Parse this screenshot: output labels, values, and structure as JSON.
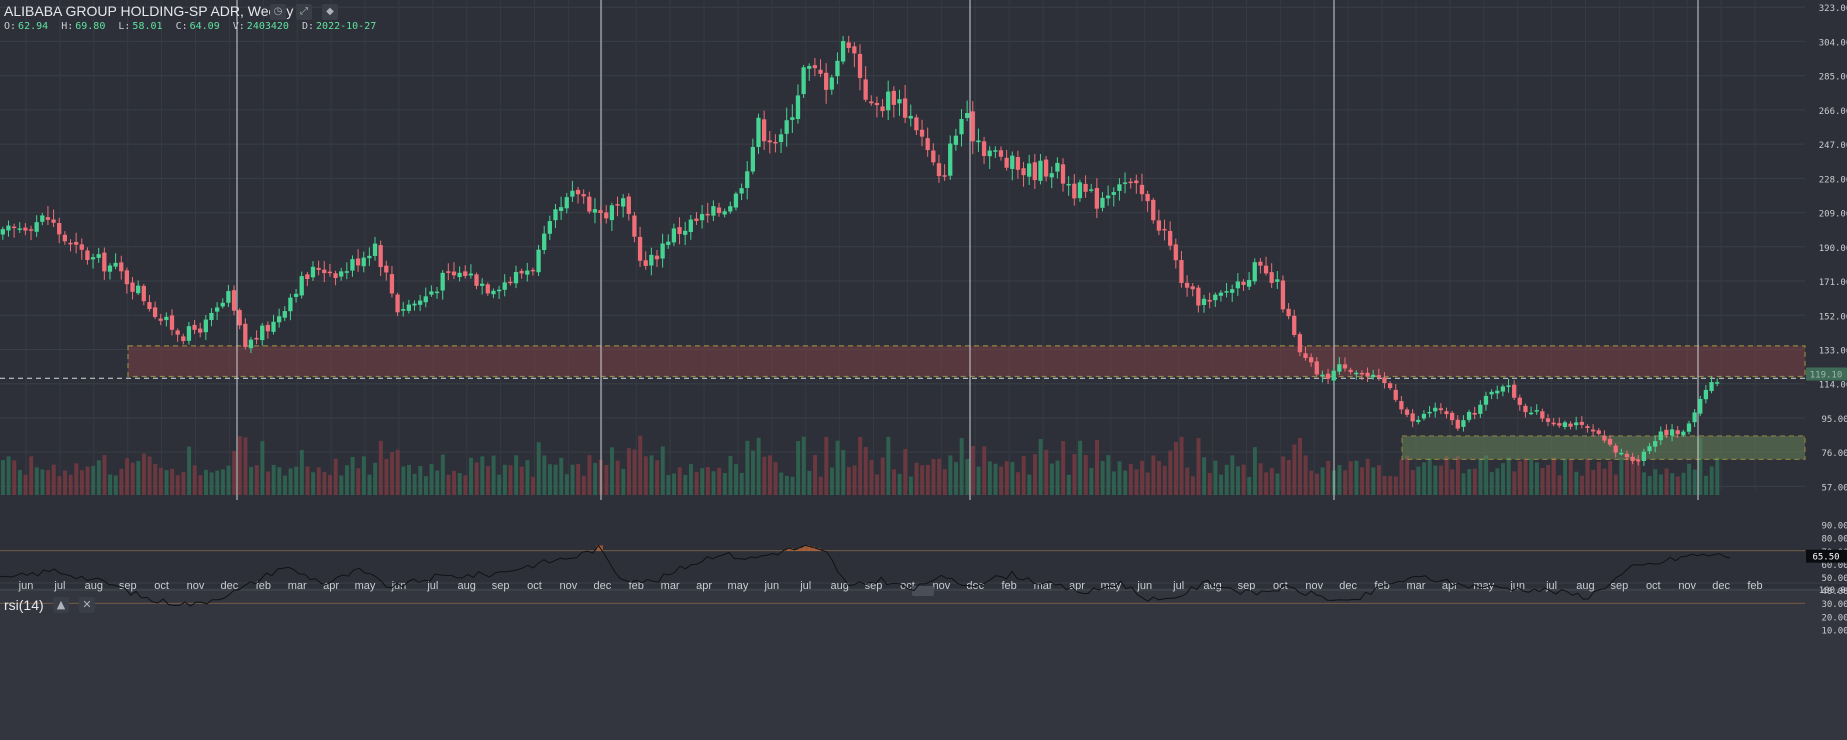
{
  "header": {
    "title": "ALIBABA GROUP HOLDING-SP ADR, Weekly",
    "ohlc": [
      {
        "key": "O:",
        "value": "62.94"
      },
      {
        "key": "H:",
        "value": "69.80"
      },
      {
        "key": "L:",
        "value": "58.01"
      },
      {
        "key": "C:",
        "value": "64.09"
      },
      {
        "key": "V:",
        "value": "2403420"
      },
      {
        "key": "D:",
        "value": "2022-10-27"
      }
    ]
  },
  "rsi_label": "rsi(14)",
  "chart_data": [
    {
      "type": "candlestick",
      "title": "ALIBABA GROUP HOLDING-SP ADR, Weekly",
      "y_ticks": [
        "323.00",
        "304.00",
        "285.00",
        "266.00",
        "247.00",
        "228.00",
        "209.00",
        "190.00",
        "171.00",
        "152.00",
        "133.00",
        "114.00",
        "95.00",
        "76.00",
        "57.00",
        "100.00"
      ],
      "x_ticks": [
        "jun",
        "jul",
        "aug",
        "sep",
        "oct",
        "nov",
        "dec",
        "feb",
        "mar",
        "apr",
        "may",
        "jun",
        "jul",
        "aug",
        "sep",
        "oct",
        "nov",
        "dec",
        "feb",
        "mar",
        "apr",
        "may",
        "jun",
        "jul",
        "aug",
        "sep",
        "oct",
        "nov",
        "dec",
        "feb",
        "mar",
        "apr",
        "may",
        "jun",
        "jul",
        "aug",
        "sep",
        "oct",
        "nov",
        "dec",
        "feb",
        "mar",
        "apr",
        "may",
        "jun",
        "jul",
        "aug",
        "sep",
        "oct",
        "nov",
        "dec",
        "feb"
      ],
      "ylim": [
        55,
        327
      ],
      "price_anchors": [
        [
          0,
          196
        ],
        [
          4,
          203
        ],
        [
          8,
          206
        ],
        [
          12,
          190
        ],
        [
          16,
          183
        ],
        [
          20,
          178
        ],
        [
          24,
          166
        ],
        [
          28,
          150
        ],
        [
          32,
          141
        ],
        [
          36,
          147
        ],
        [
          40,
          162
        ],
        [
          43,
          135
        ],
        [
          48,
          148
        ],
        [
          52,
          168
        ],
        [
          56,
          179
        ],
        [
          60,
          176
        ],
        [
          64,
          186
        ],
        [
          66,
          192
        ],
        [
          70,
          156
        ],
        [
          74,
          160
        ],
        [
          78,
          172
        ],
        [
          82,
          176
        ],
        [
          86,
          168
        ],
        [
          90,
          172
        ],
        [
          94,
          180
        ],
        [
          98,
          206
        ],
        [
          102,
          221
        ],
        [
          106,
          208
        ],
        [
          110,
          212
        ],
        [
          114,
          178
        ],
        [
          118,
          196
        ],
        [
          122,
          203
        ],
        [
          126,
          208
        ],
        [
          130,
          218
        ],
        [
          134,
          257
        ],
        [
          138,
          248
        ],
        [
          142,
          288
        ],
        [
          146,
          283
        ],
        [
          150,
          307
        ],
        [
          154,
          266
        ],
        [
          158,
          275
        ],
        [
          162,
          258
        ],
        [
          166,
          226
        ],
        [
          170,
          262
        ],
        [
          174,
          246
        ],
        [
          178,
          236
        ],
        [
          182,
          232
        ],
        [
          186,
          235
        ],
        [
          190,
          222
        ],
        [
          194,
          216
        ],
        [
          198,
          228
        ],
        [
          202,
          218
        ],
        [
          206,
          198
        ],
        [
          210,
          164
        ],
        [
          214,
          158
        ],
        [
          218,
          168
        ],
        [
          222,
          178
        ],
        [
          226,
          168
        ],
        [
          230,
          130
        ],
        [
          234,
          117
        ],
        [
          238,
          125
        ],
        [
          242,
          118
        ],
        [
          246,
          112
        ],
        [
          250,
          92
        ],
        [
          254,
          101
        ],
        [
          258,
          90
        ],
        [
          262,
          102
        ],
        [
          266,
          115
        ],
        [
          270,
          100
        ],
        [
          274,
          94
        ],
        [
          278,
          92
        ],
        [
          282,
          87
        ],
        [
          286,
          76
        ],
        [
          290,
          72
        ],
        [
          294,
          88
        ],
        [
          298,
          86
        ],
        [
          302,
          113
        ],
        [
          304,
          116
        ]
      ],
      "last_price": "119.10",
      "reference_line": 117,
      "zones": [
        {
          "from": 118,
          "to": 135
        },
        {
          "from": 72,
          "to": 85
        }
      ],
      "vertical_markers": [
        {
          "at": "dec"
        },
        {
          "at": "dec"
        },
        {
          "at": "dec"
        },
        {
          "at": "feb"
        },
        {
          "at": "feb"
        }
      ]
    },
    {
      "type": "line",
      "name": "rsi(14)",
      "y_ticks": [
        "90.00",
        "80.00",
        "70.00",
        "60.00",
        "50.00",
        "40.00",
        "30.00",
        "20.00",
        "10.00"
      ],
      "ylim": [
        5,
        95
      ],
      "upper_band": 70,
      "lower_band": 30,
      "last_value": "65.50",
      "anchors": [
        [
          0,
          48
        ],
        [
          10,
          55
        ],
        [
          20,
          45
        ],
        [
          28,
          32
        ],
        [
          36,
          29
        ],
        [
          44,
          40
        ],
        [
          52,
          58
        ],
        [
          60,
          45
        ],
        [
          66,
          55
        ],
        [
          72,
          42
        ],
        [
          80,
          50
        ],
        [
          90,
          52
        ],
        [
          100,
          61
        ],
        [
          106,
          66
        ],
        [
          110,
          72
        ],
        [
          114,
          50
        ],
        [
          120,
          46
        ],
        [
          126,
          58
        ],
        [
          132,
          68
        ],
        [
          138,
          64
        ],
        [
          144,
          70
        ],
        [
          148,
          73
        ],
        [
          152,
          68
        ],
        [
          156,
          42
        ],
        [
          162,
          48
        ],
        [
          168,
          40
        ],
        [
          172,
          50
        ],
        [
          178,
          44
        ],
        [
          186,
          52
        ],
        [
          192,
          45
        ],
        [
          200,
          38
        ],
        [
          206,
          46
        ],
        [
          210,
          35
        ],
        [
          214,
          31
        ],
        [
          222,
          46
        ],
        [
          230,
          37
        ],
        [
          236,
          42
        ],
        [
          242,
          36
        ],
        [
          248,
          30
        ],
        [
          256,
          46
        ],
        [
          262,
          50
        ],
        [
          268,
          44
        ],
        [
          276,
          42
        ],
        [
          284,
          40
        ],
        [
          292,
          35
        ],
        [
          300,
          57
        ],
        [
          304,
          60
        ],
        [
          310,
          66
        ],
        [
          314,
          67
        ],
        [
          318,
          66
        ]
      ]
    }
  ]
}
